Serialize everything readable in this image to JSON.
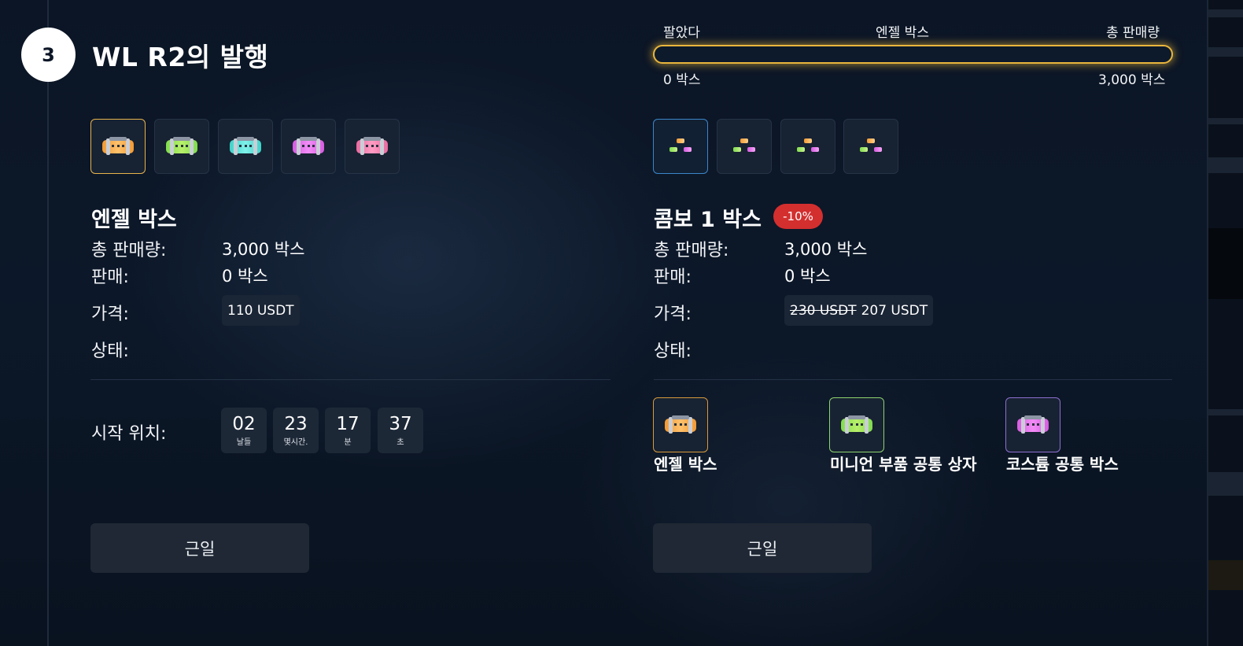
{
  "step": {
    "number": "3",
    "title": "WL R2의 발행"
  },
  "left": {
    "thumbnails": [
      {
        "name": "angel-box",
        "colors": [
          "#f29a35",
          "#ffc16b"
        ],
        "selected": true
      },
      {
        "name": "minion-box",
        "colors": [
          "#7fdc4e",
          "#b8f06a"
        ],
        "selected": false
      },
      {
        "name": "teal-box",
        "colors": [
          "#3fd2c8",
          "#7ff1ea"
        ],
        "selected": false
      },
      {
        "name": "costume-box",
        "colors": [
          "#d65be0",
          "#f28cf6"
        ],
        "selected": false
      },
      {
        "name": "pink-box",
        "colors": [
          "#e86aa0",
          "#ff9cc4"
        ],
        "selected": false
      }
    ],
    "title": "엔젤 박스",
    "total_label": "총 판매량:",
    "total_value": "3,000 박스",
    "sold_label": "판매:",
    "sold_value": "0 박스",
    "price_label": "가격:",
    "price": "110 USDT",
    "status_label": "상태:",
    "start_label": "시작 위치:",
    "countdown": [
      {
        "value": "02",
        "unit": "날들"
      },
      {
        "value": "23",
        "unit": "몇시간."
      },
      {
        "value": "17",
        "unit": "분"
      },
      {
        "value": "37",
        "unit": "초"
      }
    ],
    "button": "근일"
  },
  "right": {
    "progress": {
      "left_label": "팔았다",
      "center_label": "엔젤 박스",
      "right_label": "총 판매량",
      "min_text": "0 박스",
      "max_text": "3,000 박스",
      "fraction": 0
    },
    "thumbnails": [
      {
        "name": "combo-1",
        "selected": true
      },
      {
        "name": "combo-2",
        "selected": false
      },
      {
        "name": "combo-3",
        "selected": false
      },
      {
        "name": "combo-4",
        "selected": false
      }
    ],
    "title": "콤보 1 박스",
    "discount": "-10%",
    "total_label": "총 판매량:",
    "total_value": "3,000 박스",
    "sold_label": "판매:",
    "sold_value": "0 박스",
    "price_label": "가격:",
    "price_old": "230 USDT",
    "price_new": "207 USDT",
    "status_label": "상태:",
    "combo_items": [
      {
        "label": "엔젤 박스",
        "colors": [
          "#f29a35",
          "#ffc16b"
        ],
        "accent": "gold"
      },
      {
        "label": "미니언 부품 공통 상자",
        "colors": [
          "#7fdc4e",
          "#b8f06a"
        ],
        "accent": "green"
      },
      {
        "label": "코스튬 공통 박스",
        "colors": [
          "#d65be0",
          "#f28cf6"
        ],
        "accent": "purple"
      }
    ],
    "button": "근일"
  }
}
